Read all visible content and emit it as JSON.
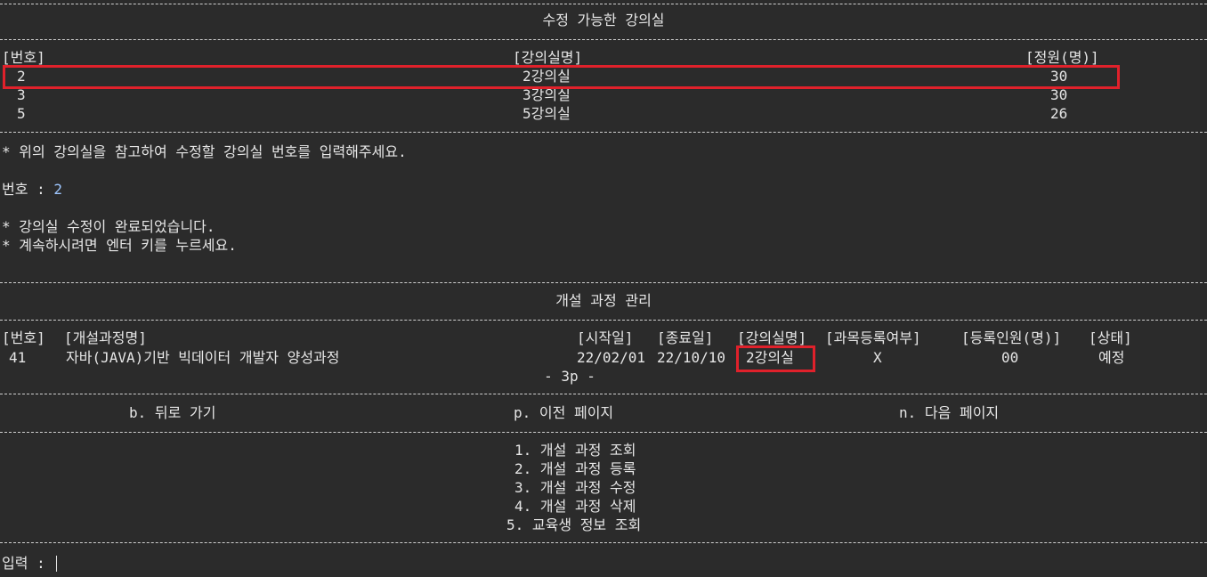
{
  "rooms": {
    "title": "수정 가능한 강의실",
    "headers": {
      "no": "[번호]",
      "name": "[강의실명]",
      "cap": "[정원(명)]"
    },
    "rows": [
      {
        "no": "2",
        "name": "2강의실",
        "cap": "30"
      },
      {
        "no": "3",
        "name": "3강의실",
        "cap": "30"
      },
      {
        "no": "5",
        "name": "5강의실",
        "cap": "26"
      }
    ],
    "instruction": "* 위의 강의실을 참고하여 수정할 강의실 번호를 입력해주세요.",
    "prompt_label": "번호 : ",
    "prompt_value": "2",
    "done_msg": "* 강의실 수정이 완료되었습니다.",
    "continue_msg": "* 계속하시려면 엔터 키를 누르세요."
  },
  "courses": {
    "title": "개설 과정 관리",
    "headers": {
      "no": "[번호]",
      "name": "[개설과정명]",
      "start": "[시작일]",
      "end": "[종료일]",
      "room": "[강의실명]",
      "reg": "[과목등록여부]",
      "count": "[등록인원(명)]",
      "status": "[상태]"
    },
    "row": {
      "no": "41",
      "name": "자바(JAVA)기반 빅데이터 개발자 양성과정",
      "start": "22/02/01",
      "end": "22/10/10",
      "room": "2강의실",
      "reg": "X",
      "count": "00",
      "status": "예정"
    },
    "page": "- 3p -"
  },
  "nav": {
    "back": "b. 뒤로 가기",
    "prev": "p. 이전 페이지",
    "next": "n. 다음 페이지"
  },
  "menu": [
    "1. 개설 과정 조회",
    "2. 개설 과정 등록",
    "3. 개설 과정 수정",
    "4. 개설 과정 삭제",
    "5. 교육생 정보 조회"
  ],
  "input_label": "입력 : ",
  "colors": {
    "highlight": "#e0212b",
    "background": "#2b2b2b",
    "text": "#e6e6e6",
    "input_value": "#9ec7ff"
  }
}
